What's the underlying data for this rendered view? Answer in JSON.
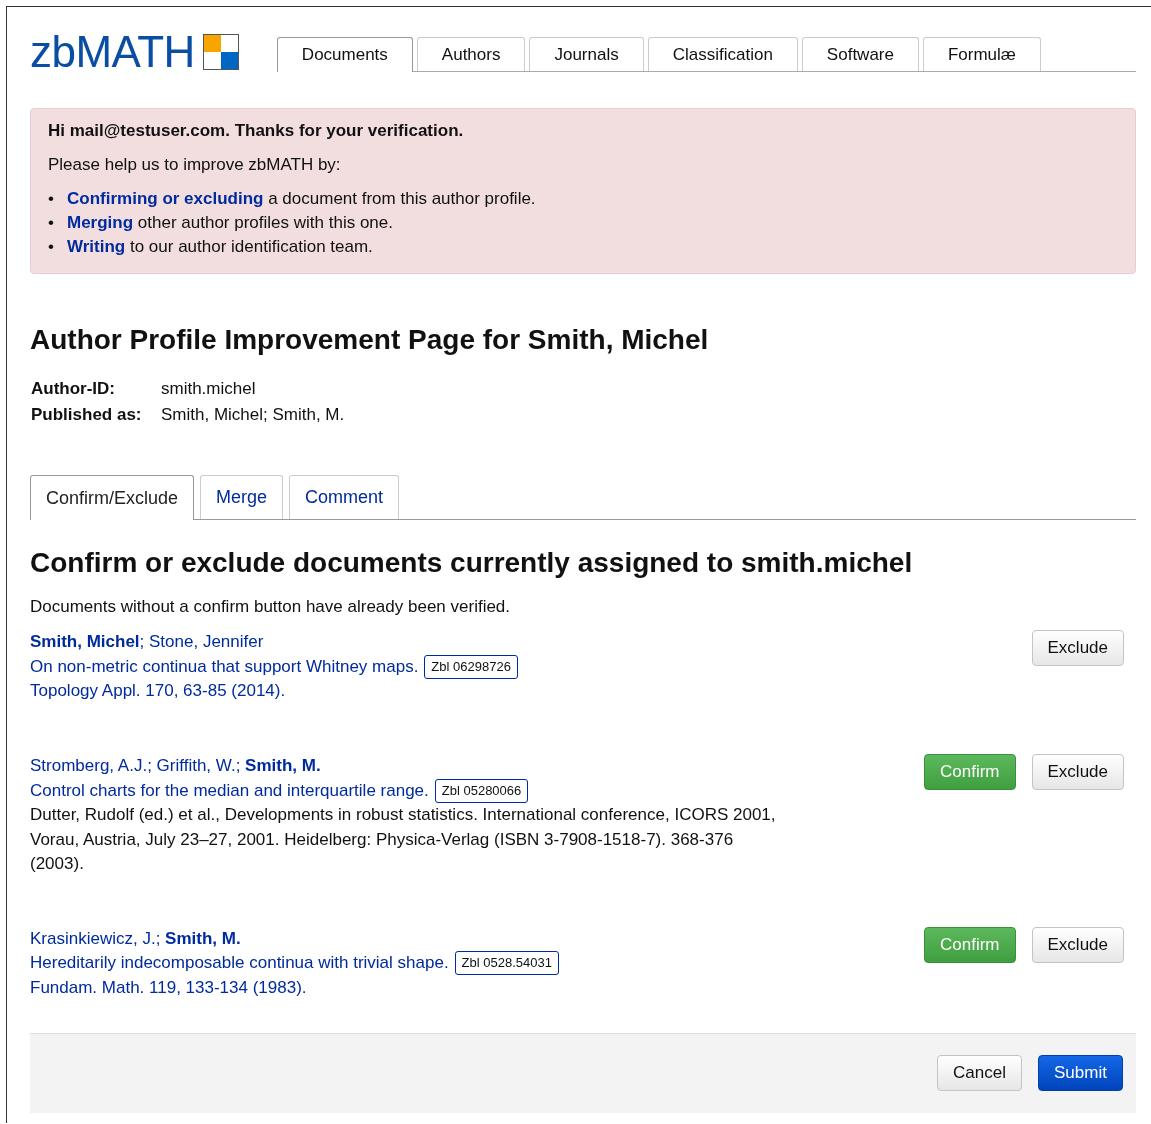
{
  "logo": {
    "text": "zbMATH"
  },
  "nav_tabs": [
    {
      "label": "Documents",
      "selected": true
    },
    {
      "label": "Authors",
      "selected": false
    },
    {
      "label": "Journals",
      "selected": false
    },
    {
      "label": "Classification",
      "selected": false
    },
    {
      "label": "Software",
      "selected": false
    },
    {
      "label": "Formulæ",
      "selected": false
    }
  ],
  "alert": {
    "greeting": "Hi mail@testuser.com. Thanks for your verification.",
    "intro": "Please help us to improve zbMATH by:",
    "items": [
      {
        "bullet": "•",
        "link": "Confirming or excluding",
        "text": " a document from this author profile."
      },
      {
        "bullet": "•",
        "link": "Merging",
        "text": " other author profiles with this one."
      },
      {
        "bullet": "•",
        "link": "Writing",
        "text": " to our author identification team."
      }
    ]
  },
  "profile": {
    "title": "Author Profile Improvement Page for Smith, Michel",
    "fields": [
      {
        "label": "Author-ID:",
        "value": "smith.michel"
      },
      {
        "label": "Published as:",
        "value": "Smith, Michel; Smith, M."
      }
    ]
  },
  "sub_tabs": [
    {
      "label": "Confirm/Exclude",
      "selected": true
    },
    {
      "label": "Merge",
      "selected": false
    },
    {
      "label": "Comment",
      "selected": false
    }
  ],
  "section": {
    "title": "Confirm or exclude documents currently assigned to smith.michel",
    "note": "Documents without a confirm button have already been verified."
  },
  "documents": [
    {
      "authors": "**Smith, Michel**; Stone, Jennifer",
      "title": "On non-metric continua that support Whitney maps.",
      "zbl": "Zbl 06298726",
      "source": "Topology Appl. 170, 63-85 (2014).",
      "source_linked": true,
      "buttons": [
        {
          "label": "Exclude",
          "kind": "exclude"
        }
      ]
    },
    {
      "authors": "Stromberg, A.J.; Griffith, W.; **Smith, M.**",
      "title": "Control charts for the median and interquartile range.",
      "zbl": "Zbl 05280066",
      "source": "Dutter, Rudolf (ed.) et al., Developments in robust statistics. International conference, ICORS 2001, Vorau, Austria, July 23–27, 2001. Heidelberg: Physica-Verlag (ISBN 3-7908-1518-7). 368-376 (2003).",
      "source_linked": false,
      "buttons": [
        {
          "label": "Confirm",
          "kind": "confirm"
        },
        {
          "label": "Exclude",
          "kind": "exclude"
        }
      ]
    },
    {
      "authors": "Krasinkiewicz, J.; **Smith, M.**",
      "title": "Hereditarily indecomposable continua with trivial shape.",
      "zbl": "Zbl 0528.54031",
      "source": "Fundam. Math. 119, 133-134 (1983).",
      "source_linked": true,
      "buttons": [
        {
          "label": "Confirm",
          "kind": "confirm"
        },
        {
          "label": "Exclude",
          "kind": "exclude"
        }
      ]
    }
  ],
  "footer": {
    "buttons": [
      {
        "label": "Cancel",
        "kind": "default"
      },
      {
        "label": "Submit",
        "kind": "primary"
      }
    ]
  }
}
